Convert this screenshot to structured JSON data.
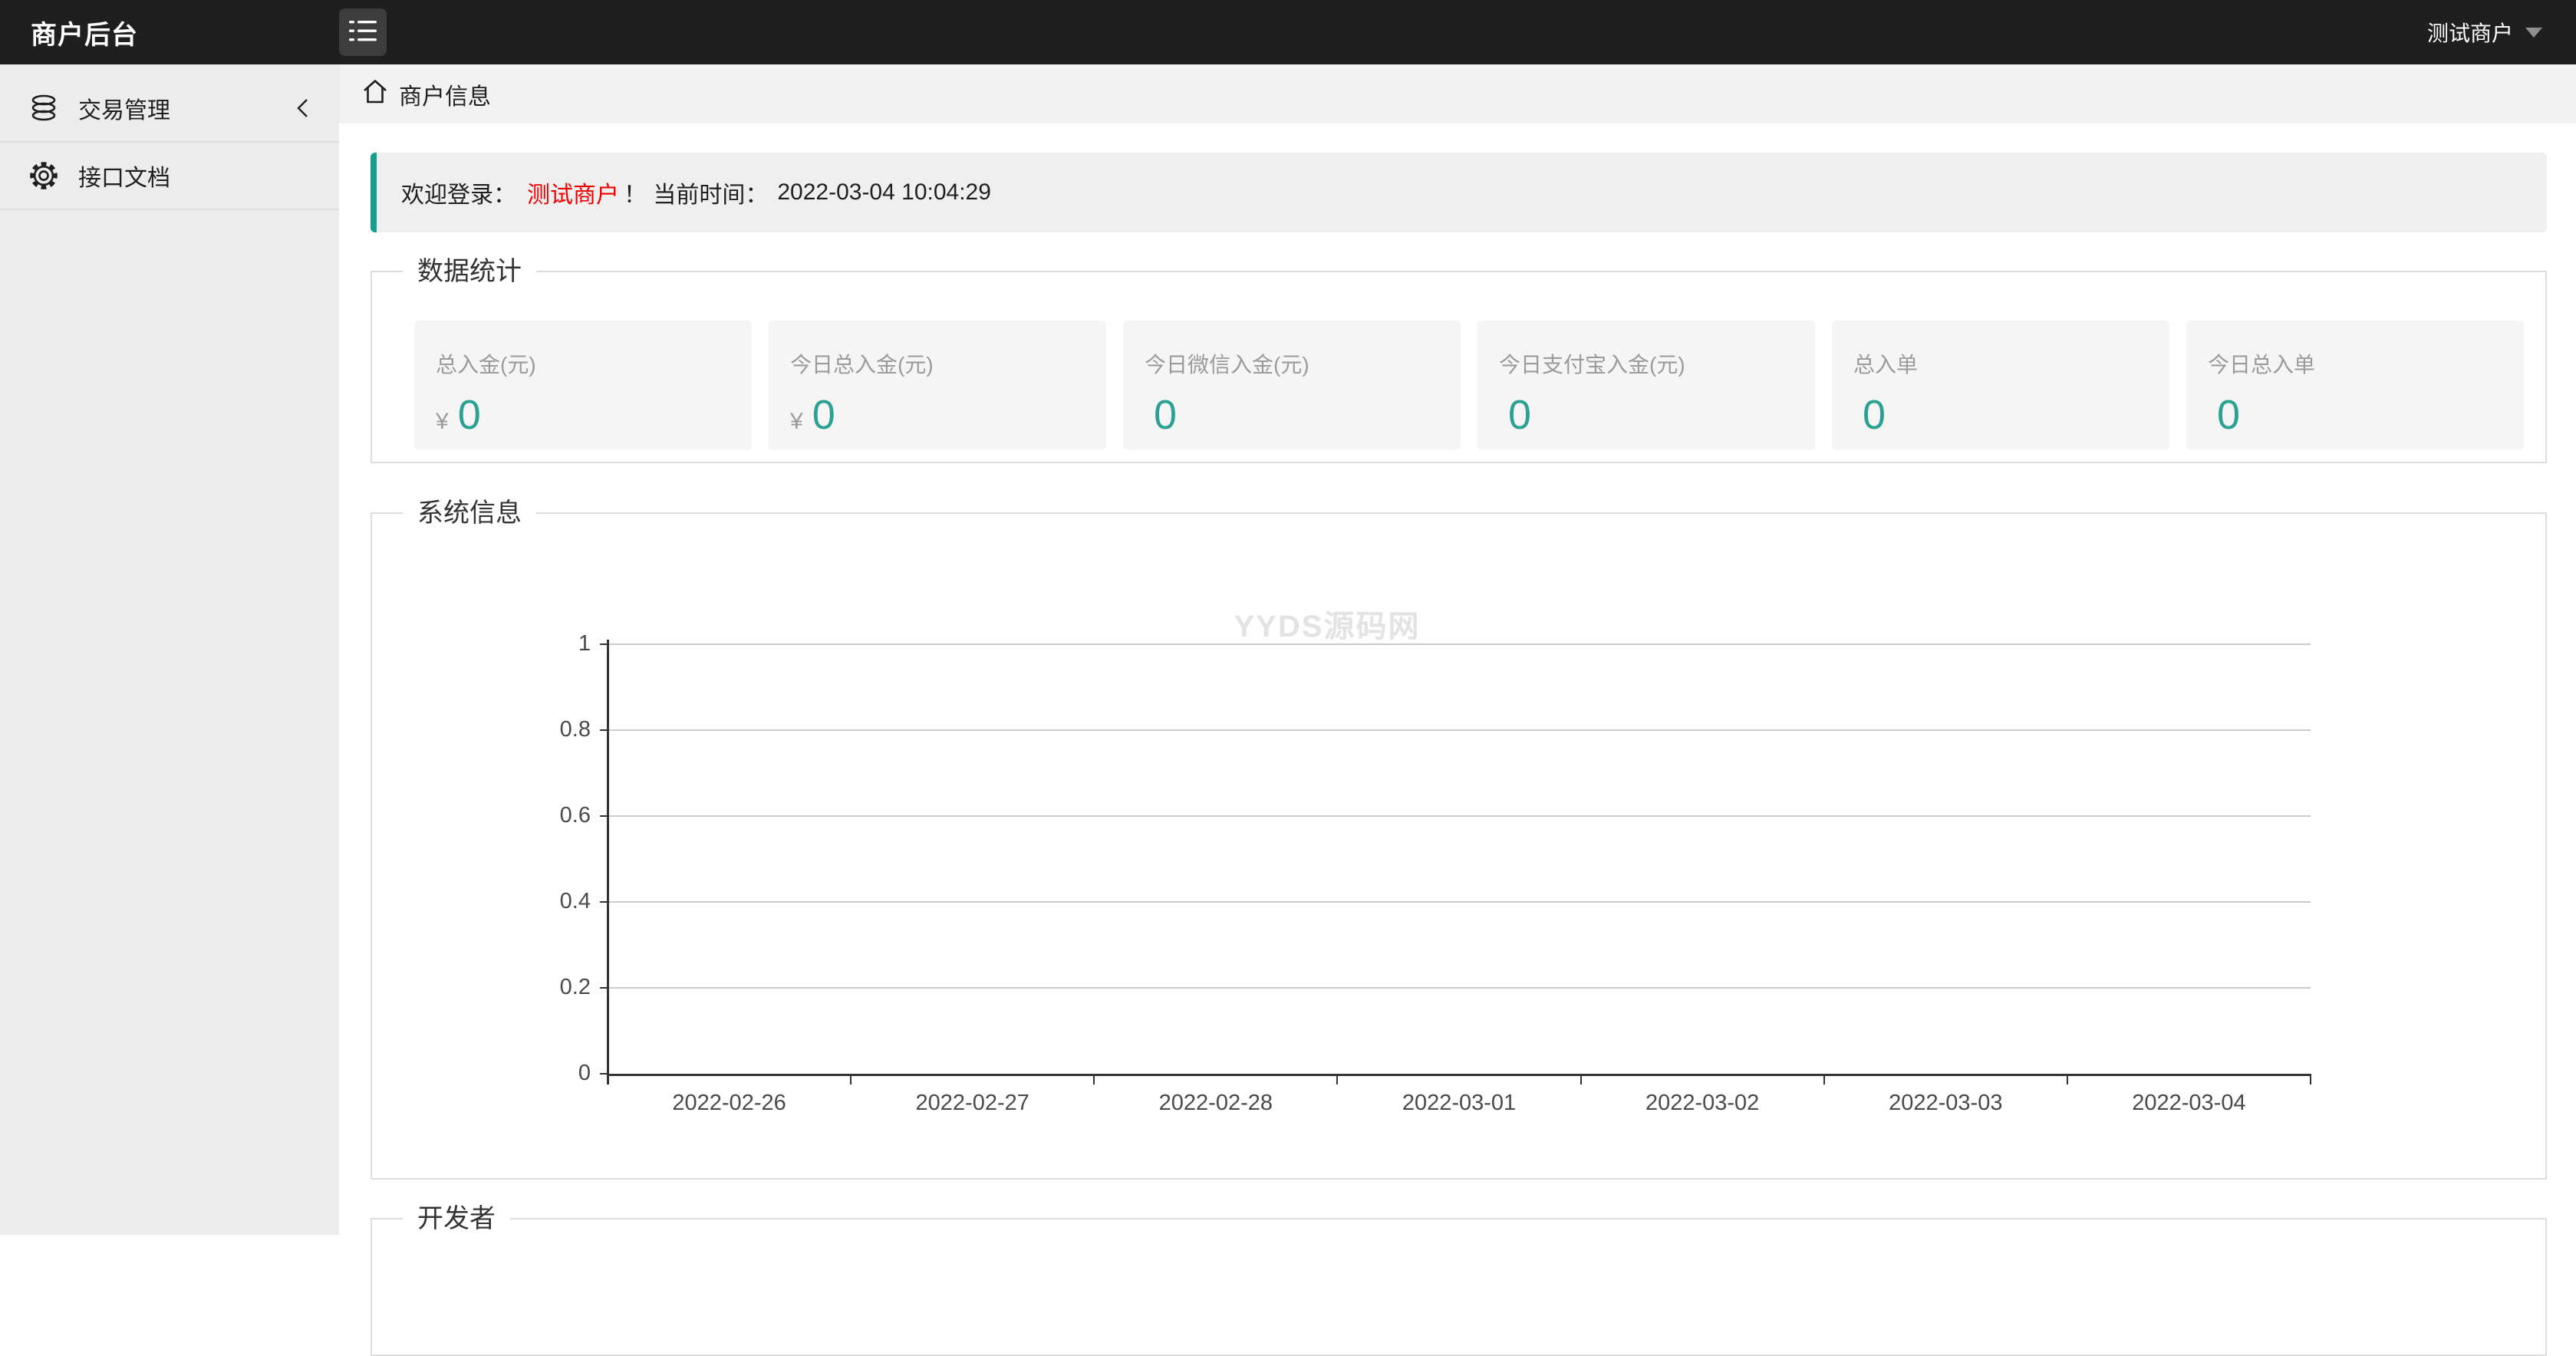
{
  "topbar": {
    "title": "商户后台",
    "user": {
      "name": "测试商户"
    }
  },
  "sidebar": {
    "items": [
      {
        "label": "交易管理",
        "icon": "database-icon",
        "has_submenu": true
      },
      {
        "label": "接口文档",
        "icon": "gear-icon",
        "has_submenu": false
      }
    ]
  },
  "breadcrumb": {
    "label": "商户信息"
  },
  "welcome": {
    "prefix": "欢迎登录：",
    "merchant": "测试商户",
    "separator": "！ 当前时间：",
    "time": "2022-03-04 10:04:29"
  },
  "sections": {
    "stats_title": "数据统计",
    "system_title": "系统信息",
    "developer_title": "开发者"
  },
  "stats": {
    "cards": [
      {
        "label": "总入金(元)",
        "currency": "¥",
        "value": "0"
      },
      {
        "label": "今日总入金(元)",
        "currency": "¥",
        "value": "0"
      },
      {
        "label": "今日微信入金(元)",
        "currency": "",
        "value": "0"
      },
      {
        "label": "今日支付宝入金(元)",
        "currency": "",
        "value": "0"
      },
      {
        "label": "总入单",
        "currency": "",
        "value": "0"
      },
      {
        "label": "今日总入单",
        "currency": "",
        "value": "0"
      }
    ]
  },
  "chart_data": {
    "type": "line",
    "title": "",
    "categories": [
      "2022-02-26",
      "2022-02-27",
      "2022-02-28",
      "2022-03-01",
      "2022-03-02",
      "2022-03-03",
      "2022-03-04"
    ],
    "series": [],
    "y_ticks": [
      1,
      0.8,
      0.6,
      0.4,
      0.2,
      0
    ],
    "ylim": [
      0,
      1
    ],
    "grid": true,
    "legend": false,
    "watermark": "YYDS源码网"
  },
  "colors": {
    "topbar_bg": "#1f1f1f",
    "accent_teal": "#189e8d",
    "value_teal": "#2aa191",
    "alert_red": "#ee0000",
    "sidebar_bg": "#ececec",
    "panel_border": "#dddddd",
    "gridline": "#cccccc",
    "axis": "#333333"
  }
}
